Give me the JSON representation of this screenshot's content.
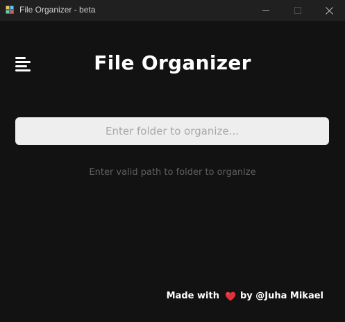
{
  "window": {
    "title": "File Organizer - beta",
    "controls": [
      "minimize",
      "maximize",
      "close"
    ]
  },
  "header": {
    "menu_icon": "hamburger-menu-icon",
    "title": "File Organizer"
  },
  "folder_input": {
    "value": "",
    "placeholder": "Enter folder to organize..."
  },
  "status_hint": "Enter valid path to folder to organize",
  "footer": {
    "made_with": "Made with",
    "heart_icon": "heart-icon",
    "by": "by @Juha Mikael"
  },
  "colors": {
    "background": "#121212",
    "titlebar": "#202020",
    "input_bg": "#eeeeee",
    "hint_text": "#5f5f5f",
    "heart": "#e0323c"
  }
}
